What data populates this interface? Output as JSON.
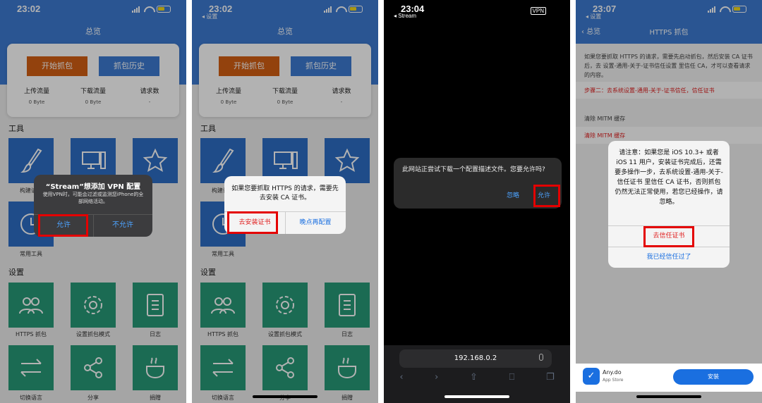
{
  "screens": [
    {
      "status_time": "23:02",
      "header_title": "总览",
      "buttons": {
        "start": "开始抓包",
        "history": "抓包历史"
      },
      "stats": [
        {
          "label": "上传流量",
          "value": "0 Byte"
        },
        {
          "label": "下载流量",
          "value": "0 Byte"
        },
        {
          "label": "请求数",
          "value": "-"
        }
      ],
      "section_tools": "工具",
      "tools": [
        "构建请求",
        "",
        "",
        "常用工具"
      ],
      "section_settings": "设置",
      "settings": [
        "HTTPS 抓包",
        "设置抓包模式",
        "日志",
        "切换语言",
        "分享",
        "捐赠"
      ],
      "alert": {
        "title": "“Stream”想添加 VPN 配置",
        "message": "使用VPN时，可能会过滤或监测您iPhone的全部网络活动。",
        "allow": "允许",
        "deny": "不允许"
      }
    },
    {
      "status_time": "23:02",
      "status_back": "◂ 设置",
      "header_title": "总览",
      "alert": {
        "message": "如果您要抓取 HTTPS 的请求，需要先去安装 CA 证书。",
        "install": "去安装证书",
        "later": "晚点再配置"
      }
    },
    {
      "status_time": "23:04",
      "status_back": "◂ Stream",
      "vpn_badge": "VPN",
      "alert": {
        "message": "此网站正尝试下载一个配置描述文件。您要允许吗?",
        "ignore": "忽略",
        "allow": "允许"
      },
      "url": "192.168.0.2"
    },
    {
      "status_time": "23:07",
      "status_back": "◂ 设置",
      "nav_back": "总览",
      "nav_title": "HTTPS 抓包",
      "description": "如果您要抓取 HTTPS 的请求，需要先启动抓包，然后安装 CA 证书后，去 设置-通用-关于-证书信任设置 里信任 CA，才可以查看请求的内容。",
      "step2": "步骤二：去系统设置-通用-关于-证书信任，信任证书",
      "clear_header": "清除 MITM 缓存",
      "clear_action": "清除 MITM 缓存",
      "alert": {
        "message": "请注意：如果您是 iOS 10.3+ 或者 iOS 11 用户，安装证书完成后，还需要多操作一步，去系统设置-通用-关于-信任证书 里信任 CA 证书，否则抓包仍然无法正常使用，若您已经操作，请忽略。",
        "trust": "去信任证书",
        "done": "我已经信任过了"
      },
      "ad": {
        "name": "Any.do",
        "store": "App Store",
        "install": "安装"
      }
    }
  ],
  "colors": {
    "header_blue": "#3d7ad1",
    "orange": "#d35f14",
    "tile_blue": "#2d6dc4",
    "tile_green": "#279a78",
    "highlight_red": "#e40000",
    "ios_blue": "#1a6fe0"
  }
}
